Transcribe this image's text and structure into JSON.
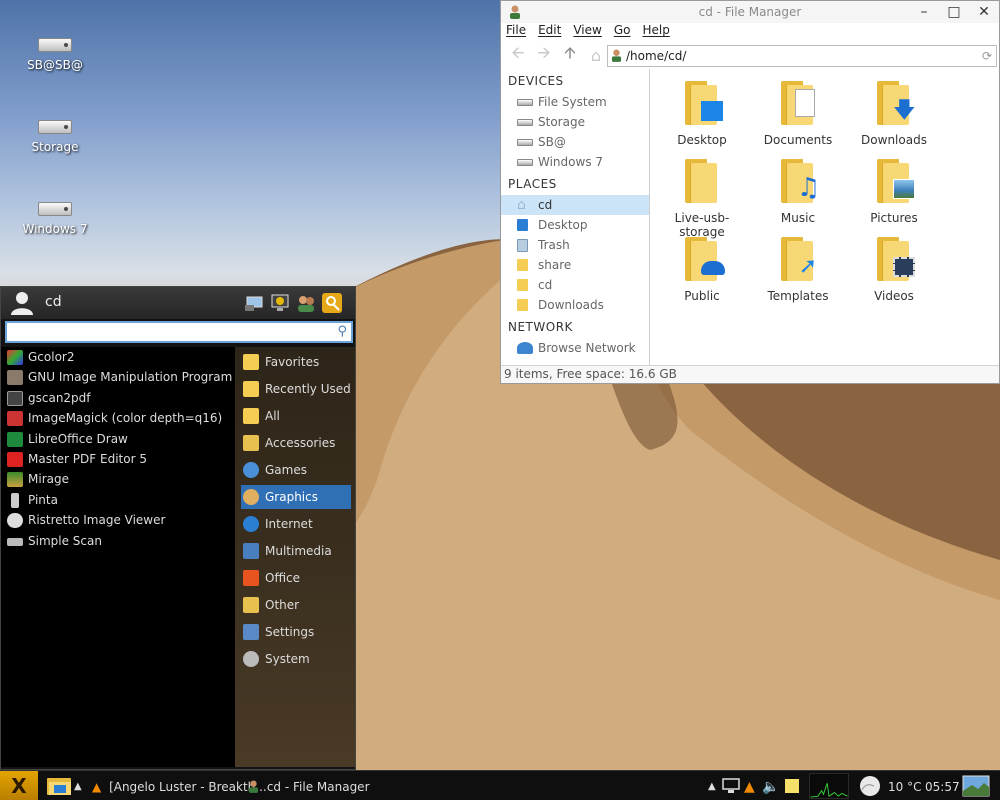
{
  "desktop": {
    "icons": [
      {
        "label": "SB@SB@"
      },
      {
        "label": "Storage"
      },
      {
        "label": "Windows 7"
      }
    ]
  },
  "file_manager": {
    "title": "cd - File Manager",
    "menu": [
      "File",
      "Edit",
      "View",
      "Go",
      "Help"
    ],
    "path": "/home/cd/",
    "devices_header": "DEVICES",
    "devices": [
      "File System",
      "Storage",
      "SB@",
      "Windows 7"
    ],
    "places_header": "PLACES",
    "places": [
      "cd",
      "Desktop",
      "Trash",
      "share",
      "cd",
      "Downloads"
    ],
    "network_header": "NETWORK",
    "network": [
      "Browse Network"
    ],
    "items": [
      "Desktop",
      "Documents",
      "Downloads",
      "Live-usb-storage",
      "Music",
      "Pictures",
      "Public",
      "Templates",
      "Videos"
    ],
    "status": "9 items, Free space: 16.6 GB"
  },
  "start_menu": {
    "username": "cd",
    "search_value": "",
    "apps": [
      "Gcolor2",
      "GNU Image Manipulation Program",
      "gscan2pdf",
      "ImageMagick (color depth=q16)",
      "LibreOffice Draw",
      "Master PDF Editor 5",
      "Mirage",
      "Pinta",
      "Ristretto Image Viewer",
      "Simple Scan"
    ],
    "categories": [
      "Favorites",
      "Recently Used",
      "All",
      "Accessories",
      "Games",
      "Graphics",
      "Internet",
      "Multimedia",
      "Office",
      "Other",
      "Settings",
      "System"
    ],
    "selected_category": "Graphics"
  },
  "taskbar": {
    "tasks": [
      "[Angelo Luster - Breakth...",
      "cd - File Manager"
    ],
    "weather": "10 °C",
    "clock": "05:57"
  }
}
